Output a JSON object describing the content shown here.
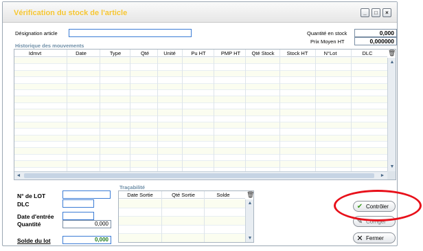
{
  "window": {
    "title": "Vérification du stock de l'article",
    "controls": [
      "_",
      "□",
      "×"
    ]
  },
  "article": {
    "designation_label": "Désignation article",
    "designation_value": "",
    "qty_label": "Quantité en stock",
    "qty_value": "0,000",
    "price_label": "Prix Moyen HT",
    "price_value": "0,000000"
  },
  "history": {
    "title": "Historique des mouvements",
    "columns": [
      "Idmvt",
      "Date",
      "Type",
      "Qté",
      "Unité",
      "Pu HT",
      "PMP HT",
      "Qté Stock",
      "Stock HT",
      "N°Lot",
      "DLC"
    ],
    "rows": []
  },
  "lot": {
    "lot_label": "N° de LOT",
    "lot_value": "",
    "dlc_label": "DLC",
    "dlc_value": "",
    "date_label": "Date d'entrée",
    "date_value": "",
    "qty_label": "Quantité",
    "qty_value": "0,000",
    "balance_label": "Solde du lot",
    "balance_value": "0,000"
  },
  "traceability": {
    "title": "Traçabilité",
    "columns": [
      "Date Sortie",
      "Qté Sortie",
      "Solde"
    ],
    "rows": []
  },
  "buttons": {
    "check": "Contrôler",
    "fix": "Corriger",
    "close": "Fermer"
  },
  "icons": {
    "check": "check-icon",
    "fix": "pencil-icon",
    "close": "close-x-icon",
    "trash": "trash-icon"
  },
  "colors": {
    "title": "#f4c430",
    "section": "#6f8fa8",
    "highlight": "#e8101a",
    "balance": "#1e7a1e"
  }
}
